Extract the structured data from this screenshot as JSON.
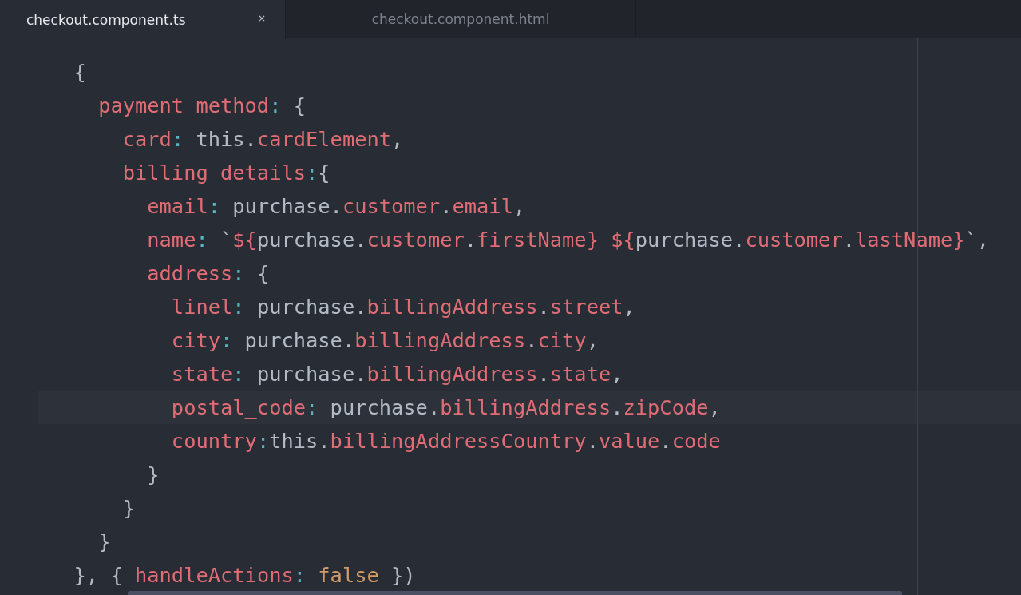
{
  "tabs": [
    {
      "title": "checkout.component.ts",
      "close": "×",
      "selected": true
    },
    {
      "title": "checkout.component.html",
      "selected": false
    }
  ],
  "editor": {
    "lines": [
      {
        "current": false,
        "tokens": [
          {
            "text": "  {",
            "kind": "plain"
          }
        ]
      },
      {
        "current": false,
        "tokens": [
          {
            "text": "    payment_method",
            "kind": "property"
          },
          {
            "text": ":",
            "kind": "operator"
          },
          {
            "text": " {",
            "kind": "plain"
          }
        ]
      },
      {
        "current": false,
        "tokens": [
          {
            "text": "      card",
            "kind": "property"
          },
          {
            "text": ":",
            "kind": "operator"
          },
          {
            "text": " this.",
            "kind": "plain"
          },
          {
            "text": "cardElement",
            "kind": "property"
          },
          {
            "text": ",",
            "kind": "plain"
          }
        ]
      },
      {
        "current": false,
        "tokens": [
          {
            "text": "      billing_details",
            "kind": "property"
          },
          {
            "text": ":",
            "kind": "operator"
          },
          {
            "text": "{",
            "kind": "plain"
          }
        ]
      },
      {
        "current": false,
        "tokens": [
          {
            "text": "        email",
            "kind": "property"
          },
          {
            "text": ":",
            "kind": "operator"
          },
          {
            "text": " purchase.",
            "kind": "plain"
          },
          {
            "text": "customer",
            "kind": "property"
          },
          {
            "text": ".",
            "kind": "plain"
          },
          {
            "text": "email",
            "kind": "property"
          },
          {
            "text": ",",
            "kind": "plain"
          }
        ]
      },
      {
        "current": false,
        "tokens": [
          {
            "text": "        name",
            "kind": "property"
          },
          {
            "text": ":",
            "kind": "operator"
          },
          {
            "text": " `",
            "kind": "plain"
          },
          {
            "text": "${",
            "kind": "property"
          },
          {
            "text": "purchase.",
            "kind": "plain"
          },
          {
            "text": "customer",
            "kind": "property"
          },
          {
            "text": ".",
            "kind": "plain"
          },
          {
            "text": "firstName",
            "kind": "property"
          },
          {
            "text": "}",
            "kind": "property"
          },
          {
            "text": " ${",
            "kind": "property"
          },
          {
            "text": "purchase.",
            "kind": "plain"
          },
          {
            "text": "customer",
            "kind": "property"
          },
          {
            "text": ".",
            "kind": "plain"
          },
          {
            "text": "lastName",
            "kind": "property"
          },
          {
            "text": "}",
            "kind": "property"
          },
          {
            "text": "`,",
            "kind": "plain"
          }
        ]
      },
      {
        "current": false,
        "tokens": [
          {
            "text": "        address",
            "kind": "property"
          },
          {
            "text": ":",
            "kind": "operator"
          },
          {
            "text": " {",
            "kind": "plain"
          }
        ]
      },
      {
        "current": false,
        "tokens": [
          {
            "text": "          linel",
            "kind": "property"
          },
          {
            "text": ":",
            "kind": "operator"
          },
          {
            "text": " purchase.",
            "kind": "plain"
          },
          {
            "text": "billingAddress",
            "kind": "property"
          },
          {
            "text": ".",
            "kind": "plain"
          },
          {
            "text": "street",
            "kind": "property"
          },
          {
            "text": ",",
            "kind": "plain"
          }
        ]
      },
      {
        "current": false,
        "tokens": [
          {
            "text": "          city",
            "kind": "property"
          },
          {
            "text": ":",
            "kind": "operator"
          },
          {
            "text": " purchase.",
            "kind": "plain"
          },
          {
            "text": "billingAddress",
            "kind": "property"
          },
          {
            "text": ".",
            "kind": "plain"
          },
          {
            "text": "city",
            "kind": "property"
          },
          {
            "text": ",",
            "kind": "plain"
          }
        ]
      },
      {
        "current": false,
        "tokens": [
          {
            "text": "          state",
            "kind": "property"
          },
          {
            "text": ":",
            "kind": "operator"
          },
          {
            "text": " purchase.",
            "kind": "plain"
          },
          {
            "text": "billingAddress",
            "kind": "property"
          },
          {
            "text": ".",
            "kind": "plain"
          },
          {
            "text": "state",
            "kind": "property"
          },
          {
            "text": ",",
            "kind": "plain"
          }
        ]
      },
      {
        "current": true,
        "tokens": [
          {
            "text": "          postal_code",
            "kind": "property"
          },
          {
            "text": ":",
            "kind": "operator"
          },
          {
            "text": " purchase.",
            "kind": "plain"
          },
          {
            "text": "billingAddress",
            "kind": "property"
          },
          {
            "text": ".",
            "kind": "plain"
          },
          {
            "text": "zipCode",
            "kind": "property"
          },
          {
            "text": ",",
            "kind": "plain"
          }
        ]
      },
      {
        "current": false,
        "tokens": [
          {
            "text": "          country",
            "kind": "property"
          },
          {
            "text": ":",
            "kind": "operator"
          },
          {
            "text": "this.",
            "kind": "plain"
          },
          {
            "text": "billingAddressCountry",
            "kind": "property"
          },
          {
            "text": ".",
            "kind": "plain"
          },
          {
            "text": "value",
            "kind": "property"
          },
          {
            "text": ".",
            "kind": "plain"
          },
          {
            "text": "code",
            "kind": "property"
          }
        ]
      },
      {
        "current": false,
        "tokens": [
          {
            "text": "        }",
            "kind": "plain"
          }
        ]
      },
      {
        "current": false,
        "tokens": [
          {
            "text": "      }",
            "kind": "plain"
          }
        ]
      },
      {
        "current": false,
        "tokens": [
          {
            "text": "    }",
            "kind": "plain"
          }
        ]
      },
      {
        "current": false,
        "tokens": [
          {
            "text": "  }, { ",
            "kind": "plain"
          },
          {
            "text": "handleActions",
            "kind": "property"
          },
          {
            "text": ":",
            "kind": "operator"
          },
          {
            "text": " false",
            "kind": "boolean"
          },
          {
            "text": " })",
            "kind": "plain"
          }
        ]
      }
    ]
  }
}
